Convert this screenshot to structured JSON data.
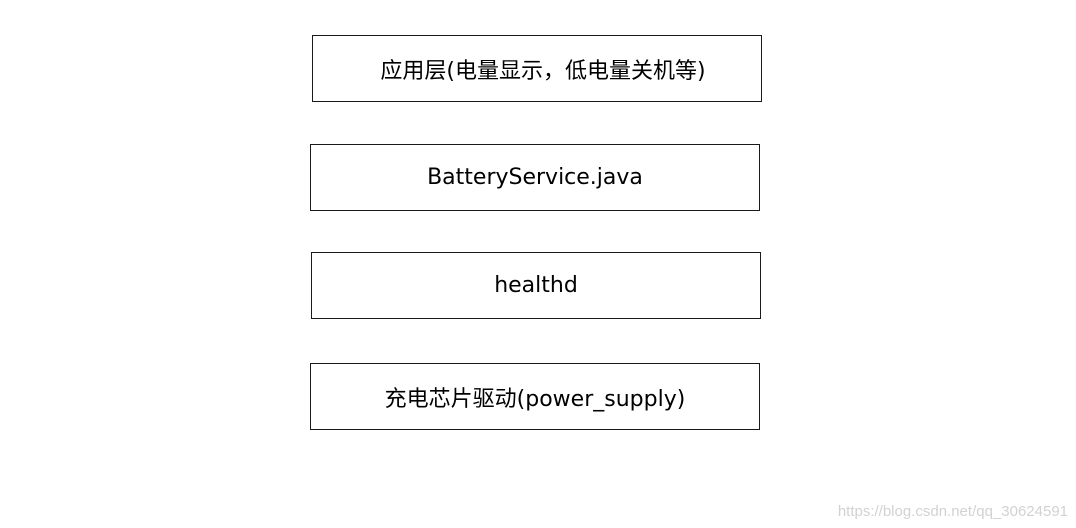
{
  "layers": [
    {
      "id": "app",
      "label": "应用层(电量显示，低电量关机等)"
    },
    {
      "id": "service",
      "label": "BatteryService.java"
    },
    {
      "id": "healthd",
      "label": "healthd"
    },
    {
      "id": "driver",
      "label": "充电芯片驱动(power_supply)"
    }
  ],
  "watermark": "https://blog.csdn.net/qq_30624591"
}
